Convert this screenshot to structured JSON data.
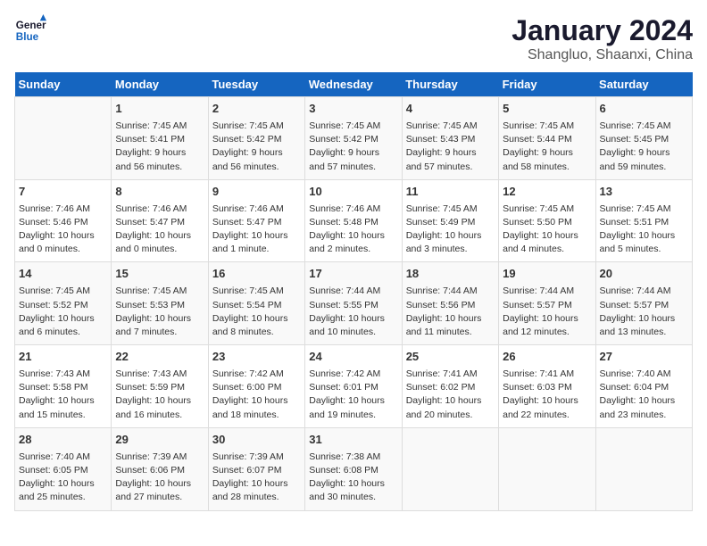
{
  "logo": {
    "line1": "General",
    "line2": "Blue"
  },
  "title": "January 2024",
  "subtitle": "Shangluo, Shaanxi, China",
  "headers": [
    "Sunday",
    "Monday",
    "Tuesday",
    "Wednesday",
    "Thursday",
    "Friday",
    "Saturday"
  ],
  "weeks": [
    [
      {
        "day": "",
        "info": ""
      },
      {
        "day": "1",
        "info": "Sunrise: 7:45 AM\nSunset: 5:41 PM\nDaylight: 9 hours\nand 56 minutes."
      },
      {
        "day": "2",
        "info": "Sunrise: 7:45 AM\nSunset: 5:42 PM\nDaylight: 9 hours\nand 56 minutes."
      },
      {
        "day": "3",
        "info": "Sunrise: 7:45 AM\nSunset: 5:42 PM\nDaylight: 9 hours\nand 57 minutes."
      },
      {
        "day": "4",
        "info": "Sunrise: 7:45 AM\nSunset: 5:43 PM\nDaylight: 9 hours\nand 57 minutes."
      },
      {
        "day": "5",
        "info": "Sunrise: 7:45 AM\nSunset: 5:44 PM\nDaylight: 9 hours\nand 58 minutes."
      },
      {
        "day": "6",
        "info": "Sunrise: 7:45 AM\nSunset: 5:45 PM\nDaylight: 9 hours\nand 59 minutes."
      }
    ],
    [
      {
        "day": "7",
        "info": "Sunrise: 7:46 AM\nSunset: 5:46 PM\nDaylight: 10 hours\nand 0 minutes."
      },
      {
        "day": "8",
        "info": "Sunrise: 7:46 AM\nSunset: 5:47 PM\nDaylight: 10 hours\nand 0 minutes."
      },
      {
        "day": "9",
        "info": "Sunrise: 7:46 AM\nSunset: 5:47 PM\nDaylight: 10 hours\nand 1 minute."
      },
      {
        "day": "10",
        "info": "Sunrise: 7:46 AM\nSunset: 5:48 PM\nDaylight: 10 hours\nand 2 minutes."
      },
      {
        "day": "11",
        "info": "Sunrise: 7:45 AM\nSunset: 5:49 PM\nDaylight: 10 hours\nand 3 minutes."
      },
      {
        "day": "12",
        "info": "Sunrise: 7:45 AM\nSunset: 5:50 PM\nDaylight: 10 hours\nand 4 minutes."
      },
      {
        "day": "13",
        "info": "Sunrise: 7:45 AM\nSunset: 5:51 PM\nDaylight: 10 hours\nand 5 minutes."
      }
    ],
    [
      {
        "day": "14",
        "info": "Sunrise: 7:45 AM\nSunset: 5:52 PM\nDaylight: 10 hours\nand 6 minutes."
      },
      {
        "day": "15",
        "info": "Sunrise: 7:45 AM\nSunset: 5:53 PM\nDaylight: 10 hours\nand 7 minutes."
      },
      {
        "day": "16",
        "info": "Sunrise: 7:45 AM\nSunset: 5:54 PM\nDaylight: 10 hours\nand 8 minutes."
      },
      {
        "day": "17",
        "info": "Sunrise: 7:44 AM\nSunset: 5:55 PM\nDaylight: 10 hours\nand 10 minutes."
      },
      {
        "day": "18",
        "info": "Sunrise: 7:44 AM\nSunset: 5:56 PM\nDaylight: 10 hours\nand 11 minutes."
      },
      {
        "day": "19",
        "info": "Sunrise: 7:44 AM\nSunset: 5:57 PM\nDaylight: 10 hours\nand 12 minutes."
      },
      {
        "day": "20",
        "info": "Sunrise: 7:44 AM\nSunset: 5:57 PM\nDaylight: 10 hours\nand 13 minutes."
      }
    ],
    [
      {
        "day": "21",
        "info": "Sunrise: 7:43 AM\nSunset: 5:58 PM\nDaylight: 10 hours\nand 15 minutes."
      },
      {
        "day": "22",
        "info": "Sunrise: 7:43 AM\nSunset: 5:59 PM\nDaylight: 10 hours\nand 16 minutes."
      },
      {
        "day": "23",
        "info": "Sunrise: 7:42 AM\nSunset: 6:00 PM\nDaylight: 10 hours\nand 18 minutes."
      },
      {
        "day": "24",
        "info": "Sunrise: 7:42 AM\nSunset: 6:01 PM\nDaylight: 10 hours\nand 19 minutes."
      },
      {
        "day": "25",
        "info": "Sunrise: 7:41 AM\nSunset: 6:02 PM\nDaylight: 10 hours\nand 20 minutes."
      },
      {
        "day": "26",
        "info": "Sunrise: 7:41 AM\nSunset: 6:03 PM\nDaylight: 10 hours\nand 22 minutes."
      },
      {
        "day": "27",
        "info": "Sunrise: 7:40 AM\nSunset: 6:04 PM\nDaylight: 10 hours\nand 23 minutes."
      }
    ],
    [
      {
        "day": "28",
        "info": "Sunrise: 7:40 AM\nSunset: 6:05 PM\nDaylight: 10 hours\nand 25 minutes."
      },
      {
        "day": "29",
        "info": "Sunrise: 7:39 AM\nSunset: 6:06 PM\nDaylight: 10 hours\nand 27 minutes."
      },
      {
        "day": "30",
        "info": "Sunrise: 7:39 AM\nSunset: 6:07 PM\nDaylight: 10 hours\nand 28 minutes."
      },
      {
        "day": "31",
        "info": "Sunrise: 7:38 AM\nSunset: 6:08 PM\nDaylight: 10 hours\nand 30 minutes."
      },
      {
        "day": "",
        "info": ""
      },
      {
        "day": "",
        "info": ""
      },
      {
        "day": "",
        "info": ""
      }
    ]
  ]
}
